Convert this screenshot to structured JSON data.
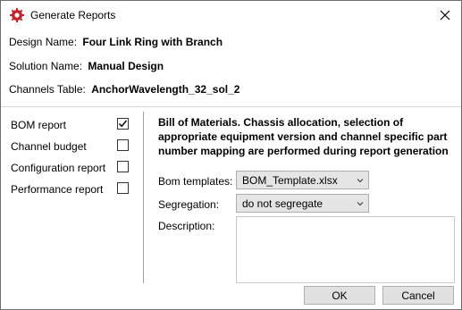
{
  "window": {
    "title": "Generate Reports",
    "icon": "gear-icon",
    "accent_color": "#c4262e"
  },
  "info": {
    "design_label": "Design Name:",
    "design_value": "Four Link Ring with Branch",
    "solution_label": "Solution Name:",
    "solution_value": "Manual Design",
    "channels_label": "Channels Table:",
    "channels_value": "AnchorWavelength_32_sol_2"
  },
  "reports": [
    {
      "label": "BOM report",
      "checked": true
    },
    {
      "label": "Channel budget",
      "checked": false
    },
    {
      "label": "Configuration report",
      "checked": false
    },
    {
      "label": "Performance report",
      "checked": false
    }
  ],
  "details": {
    "description_text": "Bill of Materials. Chassis allocation, selection of appropriate equipment version and channel specific part number mapping are performed during report generation",
    "bom_templates_label": "Bom templates:",
    "bom_templates_value": "BOM_Template.xlsx",
    "segregation_label": "Segregation:",
    "segregation_value": "do not segregate",
    "description_label": "Description:",
    "description_value": ""
  },
  "buttons": {
    "ok": "OK",
    "cancel": "Cancel"
  }
}
